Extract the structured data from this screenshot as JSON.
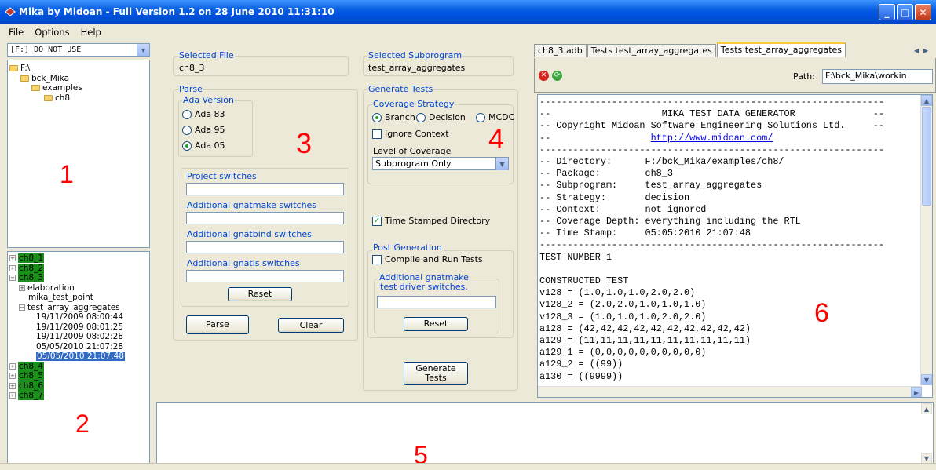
{
  "window": {
    "title": "Mika by Midoan - Full Version 1.2 on 28 June 2010 11:31:10"
  },
  "menu": [
    "File",
    "Options",
    "Help"
  ],
  "drive_select": {
    "value": "[F:] DO NOT USE"
  },
  "folder_tree": [
    "F:\\",
    "bck_Mika",
    "examples",
    "ch8"
  ],
  "marker_numbers": [
    "1",
    "2",
    "3",
    "4",
    "5",
    "6"
  ],
  "results_tree": {
    "top_items": [
      "ch8_1",
      "ch8_2",
      "ch8_3"
    ],
    "children": [
      "elaboration",
      "mika_test_point",
      "test_array_aggregates"
    ],
    "timestamps": [
      "19/11/2009 08:00:44",
      "19/11/2009 08:01:25",
      "19/11/2009 08:02:28",
      "05/05/2010 21:07:28",
      "05/05/2010 21:07:48"
    ],
    "bottom_items": [
      "ch8_4",
      "ch8_5",
      "ch8_6",
      "ch8_7"
    ]
  },
  "selected_file": {
    "label": "Selected File",
    "value": "ch8_3"
  },
  "selected_subprogram": {
    "label": "Selected Subprogram",
    "value": "test_array_aggregates"
  },
  "parse": {
    "label": "Parse",
    "ada_version_label": "Ada Version",
    "options": [
      "Ada 83",
      "Ada 95",
      "Ada 05"
    ],
    "selected": "Ada 05",
    "project_switches": "Project switches",
    "gnatmake_switches": "Additional gnatmake switches",
    "gnatbind_switches": "Additional gnatbind switches",
    "gnatls_switches": "Additional gnatls switches",
    "reset": "Reset",
    "parse_button": "Parse",
    "clear_button": "Clear"
  },
  "generate": {
    "label": "Generate Tests",
    "coverage_label": "Coverage Strategy",
    "strategies": [
      "Branch",
      "Decision",
      "MCDC"
    ],
    "ignore_context": "Ignore Context",
    "level_label": "Level of Coverage",
    "level_value": "Subprogram Only",
    "time_stamped": "Time Stamped Directory",
    "post_label": "Post Generation",
    "compile_run": "Compile and Run Tests",
    "driver_switches_1": "Additional gnatmake",
    "driver_switches_2": "test driver switches.",
    "reset": "Reset",
    "generate_1": "Generate",
    "generate_2": "Tests"
  },
  "tabs": [
    "ch8_3.adb",
    "Tests test_array_aggregates",
    "Tests test_array_aggregates"
  ],
  "path": {
    "label": "Path:",
    "value": "F:\\bck_Mika\\workin"
  },
  "console_lines": [
    "--------------------------------------------------------------",
    "--                    MIKA TEST DATA GENERATOR              --",
    "-- Copyright Midoan Software Engineering Solutions Ltd.     --",
    "--",
    "--------------------------------------------------------------",
    "-- Directory:      F:/bck_Mika/examples/ch8/",
    "-- Package:        ch8_3",
    "-- Subprogram:     test_array_aggregates",
    "-- Strategy:       decision",
    "-- Context:        not ignored",
    "-- Coverage Depth: everything including the RTL",
    "-- Time Stamp:     05:05:2010 21:07:48",
    "--------------------------------------------------------------",
    "TEST NUMBER 1",
    "",
    "CONSTRUCTED TEST",
    "v128 = (1.0,1.0,1.0,2.0,2.0)",
    "v128_2 = (2.0,2.0,1.0,1.0,1.0)",
    "v128_3 = (1.0,1.0,1.0,2.0,2.0)",
    "a128 = (42,42,42,42,42,42,42,42,42,42)",
    "a129 = (11,11,11,11,11,11,11,11,11,11)",
    "a129_1 = (0,0,0,0,0,0,0,0,0,0)",
    "a129_2 = ((99))",
    "a130 = ((9999))"
  ],
  "console_link": "http://www.midoan.com/"
}
